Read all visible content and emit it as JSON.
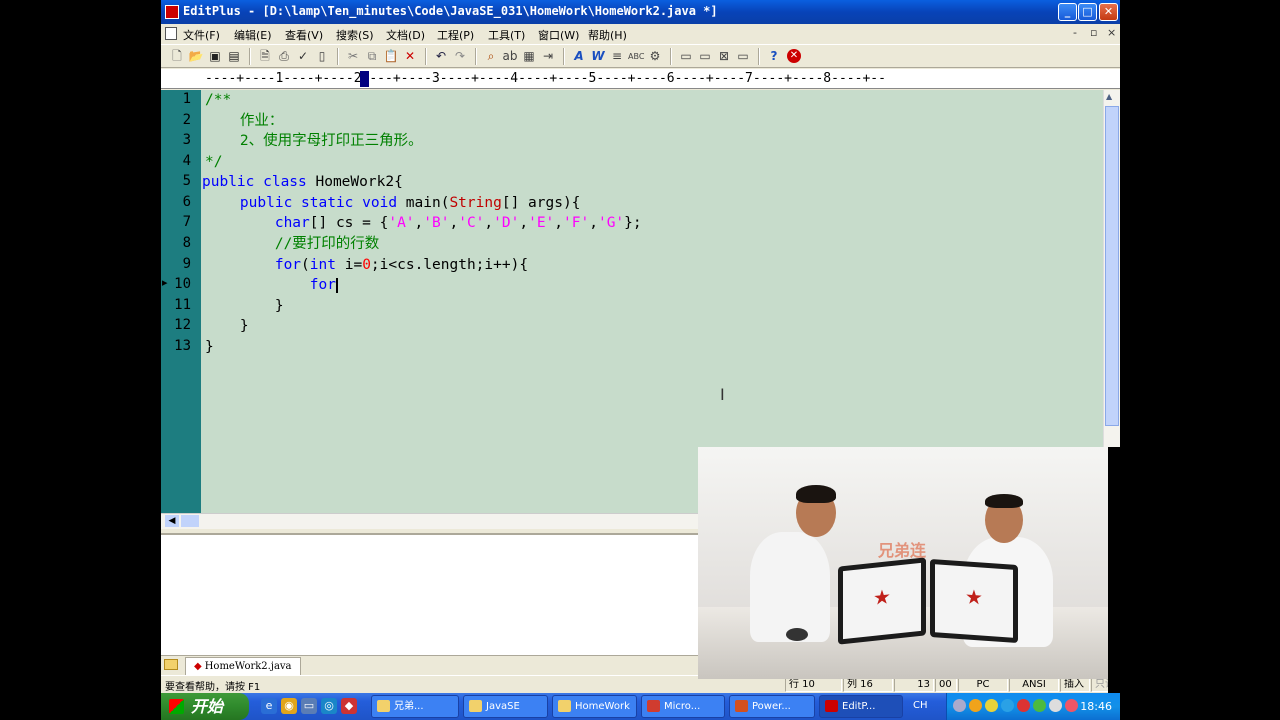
{
  "window": {
    "title": "EditPlus - [D:\\lamp\\Ten_minutes\\Code\\JavaSE_031\\HomeWork\\HomeWork2.java *]",
    "min": "_",
    "max": "□",
    "close": "✕"
  },
  "menu": [
    "文件(F)",
    "编辑(E)",
    "查看(V)",
    "搜索(S)",
    "文档(D)",
    "工程(P)",
    "工具(T)",
    "窗口(W)",
    "帮助(H)"
  ],
  "menu_controls": [
    "-",
    "▫",
    "×"
  ],
  "ruler": "----+----1----+----2----+----3----+----4----+----5----+----6----+----7----+----8----+--",
  "editor": {
    "line_numbers": [
      "1",
      "2",
      "3",
      "4",
      "5",
      "6",
      "7",
      "8",
      "9",
      "10",
      "11",
      "12",
      "13"
    ],
    "current_line": 10,
    "lines": {
      "l1": "/**",
      "l2": "    作业：",
      "l3": "    2、使用字母打印正三角形。",
      "l4": "*/",
      "l5_kw": "public class",
      "l5_rest": " HomeWork2{",
      "l6_indent": "    ",
      "l6_kw": "public static void",
      "l6_mid": " main(",
      "l6_cls": "String",
      "l6_rest": "[] args){",
      "l7_indent": "        ",
      "l7_kw": "char",
      "l7_mid": "[] cs = {",
      "l7_chars": [
        "'A'",
        "'B'",
        "'C'",
        "'D'",
        "'E'",
        "'F'",
        "'G'"
      ],
      "l7_end": "};",
      "l8_indent": "        ",
      "l8_cmt": "//要打印的行数",
      "l9_indent": "        ",
      "l9_kw1": "for",
      "l9_p1": "(",
      "l9_kw2": "int",
      "l9_p2": " i=",
      "l9_num": "0",
      "l9_rest": ";i<cs.length;i++){",
      "l10_indent": "            ",
      "l10_kw": "for",
      "l11": "        }",
      "l12": "    }",
      "l13": "}"
    }
  },
  "file_tab": "HomeWork2.java",
  "status": {
    "message": "要查看帮助，请按 F1",
    "row_label": "行 10",
    "col_label": "列 16",
    "num1": "13",
    "num2": "00",
    "mode": "PC",
    "encoding": "ANSI",
    "insert": "插入",
    "readonly": "只读"
  },
  "taskbar": {
    "start": "开始",
    "tasks": [
      "兄弟...",
      "JavaSE",
      "HomeWork",
      "Micro...",
      "Power...",
      "EditP..."
    ],
    "lang": "CH",
    "clock": "18:46"
  },
  "video_logo": "兄弟连",
  "colors": {
    "editor_bg": "#c7dccb",
    "gutter_bg": "#1d7d80",
    "keyword": "#0000ff",
    "string": "#ff00ff",
    "comment": "#008000",
    "class": "#c00000",
    "number": "#ff0000"
  }
}
